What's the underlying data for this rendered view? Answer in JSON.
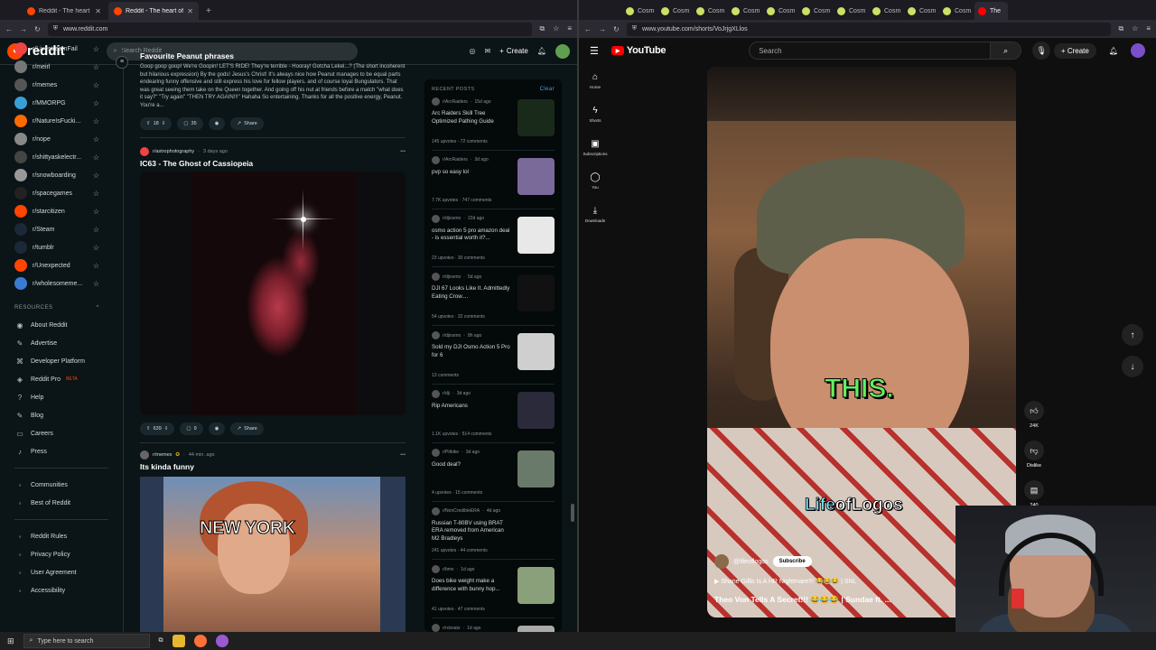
{
  "left_browser": {
    "tabs": [
      {
        "title": "Reddit - The heart of the intern"
      },
      {
        "title": "Reddit - The heart of the intern"
      }
    ],
    "url": "www.reddit.com"
  },
  "reddit": {
    "logo": "reddit",
    "search_placeholder": "Search Reddit",
    "create_label": "Create",
    "sidebar": {
      "communities": [
        {
          "name": "r/LivestreamFail",
          "color": "#e44"
        },
        {
          "name": "r/meirl",
          "color": "#777"
        },
        {
          "name": "r/memes",
          "color": "#555"
        },
        {
          "name": "r/MMORPG",
          "color": "#3a9fd6"
        },
        {
          "name": "r/NatureIsFucki...",
          "color": "#ff6a00"
        },
        {
          "name": "r/nope",
          "color": "#888"
        },
        {
          "name": "r/shittyaskelectr...",
          "color": "#444"
        },
        {
          "name": "r/snowboarding",
          "color": "#999"
        },
        {
          "name": "r/spacegames",
          "color": "#222"
        },
        {
          "name": "r/starcitizen",
          "color": "#ff4500"
        },
        {
          "name": "r/Steam",
          "color": "#1b2838"
        },
        {
          "name": "r/tumblr",
          "color": "#1b2838"
        },
        {
          "name": "r/Unexpected",
          "color": "#ff4500"
        },
        {
          "name": "r/wholesomeme...",
          "color": "#3a7bd5"
        }
      ],
      "resources_heading": "RESOURCES",
      "resources": [
        {
          "label": "About Reddit",
          "icon": "reddit-icon"
        },
        {
          "label": "Advertise",
          "icon": "megaphone-icon"
        },
        {
          "label": "Developer Platform",
          "icon": "code-icon"
        },
        {
          "label": "Reddit Pro",
          "badge": "BETA",
          "icon": "pro-icon"
        },
        {
          "label": "Help",
          "icon": "help-icon"
        },
        {
          "label": "Blog",
          "icon": "blog-icon"
        },
        {
          "label": "Careers",
          "icon": "briefcase-icon"
        },
        {
          "label": "Press",
          "icon": "mic-icon"
        }
      ],
      "bottom1": [
        {
          "label": "Communities"
        },
        {
          "label": "Best of Reddit"
        }
      ],
      "bottom2": [
        {
          "label": "Reddit Rules"
        },
        {
          "label": "Privacy Policy"
        },
        {
          "label": "User Agreement"
        },
        {
          "label": "Accessibility"
        }
      ]
    },
    "posts": [
      {
        "title": "Favourite Peanut phrases",
        "body": "Goop goop goop! We're Goopin! LET'S RIDE! They're terrible - Hooray! Gotcha Lekel...? (The short incoherent but hilarious expression) By the gods! Jesus's Christ! It's always nice how Peanut manages to be equal parts endearing funny offensive and still express his love for fellow players. and of course loyal Bungulators. That was great seeing them take on the Queen together. And going off his nut at friends before a match \"what does it say?\" \"Try again\" \"THEN TRY AGAIN!!!\" Hahaha So entertaining. Thanks for all the positive energy, Peanut. You're a...",
        "votes": "18",
        "comments": "35",
        "share": "Share"
      },
      {
        "subreddit": "r/astrophotography",
        "time": "3 days ago",
        "title": "IC63 - The Ghost of Cassiopeia",
        "votes": "639",
        "comments": "9",
        "share": "Share"
      },
      {
        "subreddit": "r/memes",
        "time": "44 min. ago",
        "title": "Its kinda funny",
        "meme_caption": "NEW YORK"
      }
    ],
    "recent": {
      "heading": "RECENT POSTS",
      "clear": "Clear",
      "items": [
        {
          "sub": "r/ArcRaiders",
          "time": "15d ago",
          "title": "Arc Raiders Skill Tree Optimized Pathing Guide",
          "stats": "145 upvotes · 72 comments",
          "thumb": "#1a2a1a"
        },
        {
          "sub": "r/ArcRaiders",
          "time": "3d ago",
          "title": "pvp so easy lol",
          "stats": "7.7K upvotes · 747 comments",
          "thumb": "#7a6a9a"
        },
        {
          "sub": "r/djiosmo",
          "time": "22d ago",
          "title": "osmo action 5 pro amazon deal - is essential worth it?...",
          "stats": "23 upvotes · 30 comments",
          "thumb": "#e8e8e8"
        },
        {
          "sub": "r/djiosmo",
          "time": "5d ago",
          "title": "DJI 67 Looks Like It. Admittedly Eating Crow....",
          "stats": "54 upvotes · 32 comments",
          "thumb": "#111"
        },
        {
          "sub": "r/djiosmo",
          "time": "8h ago",
          "title": "Sold my DJI Osmo Action 5 Pro for 6",
          "stats": "13 comments",
          "thumb": "#cfcfcf"
        },
        {
          "sub": "r/dji",
          "time": "3d ago",
          "title": "Rip Americans",
          "stats": "1.1K upvotes · 514 comments",
          "thumb": "#2a2a3a"
        },
        {
          "sub": "r/Pitbike",
          "time": "3d ago",
          "title": "Good deal?",
          "stats": "4 upvotes · 15 comments",
          "thumb": "#6a7a6a"
        },
        {
          "sub": "r/NonCredibleERA",
          "time": "4d ago",
          "title": "Russian T-80BV using BRAT ERA removed from American M2 Bradleys",
          "stats": "241 upvotes · 44 comments",
          "thumb": ""
        },
        {
          "sub": "r/bmx",
          "time": "1d ago",
          "title": "Does bike weight make a difference with bunny hop...",
          "stats": "41 upvotes · 47 comments",
          "thumb": "#8aa07a"
        },
        {
          "sub": "r/rcboats",
          "time": "1d ago",
          "title": "",
          "stats": "",
          "thumb": "#aaa"
        }
      ]
    }
  },
  "right_browser": {
    "tabs": [
      "Cosm",
      "Cosm",
      "Cosm",
      "Cosm",
      "Cosm",
      "Cosm",
      "Cosm",
      "Cosm",
      "Cosm",
      "Cosm",
      "The"
    ],
    "url": "www.youtube.com/shorts/VoJrjgXLlos"
  },
  "youtube": {
    "logo": "YouTube",
    "search_placeholder": "Search",
    "create_label": "Create",
    "nav": [
      {
        "label": "Home",
        "icon": "home-icon"
      },
      {
        "label": "Shorts",
        "icon": "shorts-icon"
      },
      {
        "label": "Subscriptions",
        "icon": "subscriptions-icon"
      },
      {
        "label": "You",
        "icon": "user-icon"
      },
      {
        "label": "Downloads",
        "icon": "download-icon"
      }
    ],
    "short": {
      "caption_top": "THIS.",
      "caption_bottom_a": "Life",
      "caption_bottom_b": "ofLogos",
      "channel": "@lifeoflogos",
      "subscribe": "Subscribe",
      "playlist_title": "Shane Gillis Is A HR Nightmare!!! 😂😂😂 | SNL",
      "title": "Theo Von Tells A Secret!!! 😂😂😂 | Sundae ft. ..."
    },
    "actions": {
      "likes": "24K",
      "dislike": "Dislike",
      "comments": "240"
    }
  },
  "taskbar": {
    "search_placeholder": "Type here to search"
  }
}
